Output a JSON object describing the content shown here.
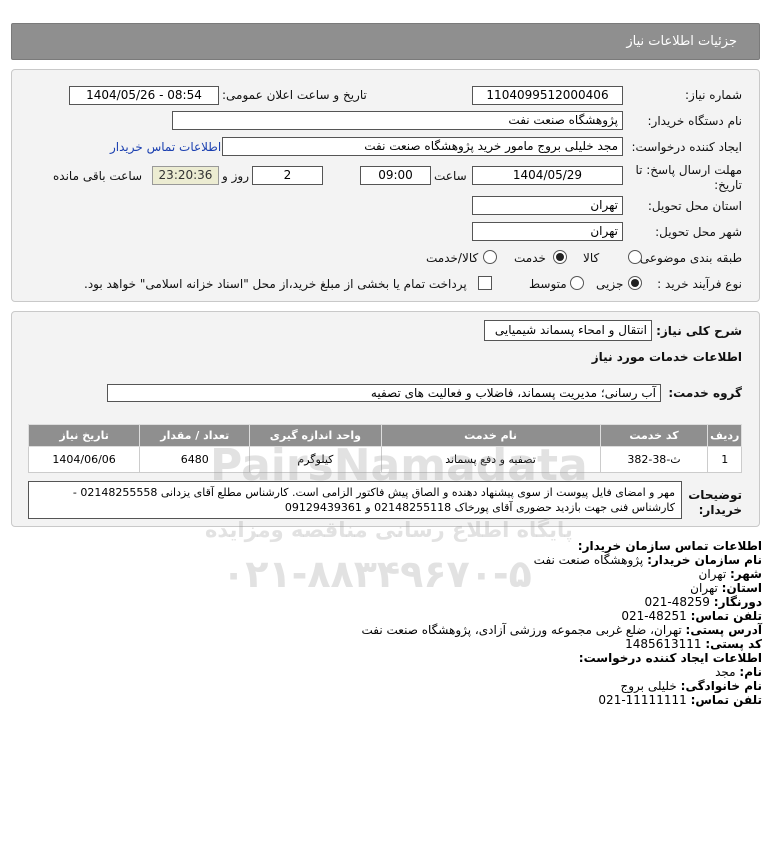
{
  "header": {
    "title": "جزئیات اطلاعات نیاز"
  },
  "form": {
    "need_number_label": "شماره نیاز:",
    "need_number": "1104099512000406",
    "announce_label": "تاریخ و ساعت اعلان عمومی:",
    "announce_value": "1404/05/26 - 08:54",
    "buyer_org_label": "نام دستگاه خریدار:",
    "buyer_org": "پژوهشگاه صنعت نفت",
    "creator_label": "ایجاد کننده درخواست:",
    "creator": "مجد خلیلی بروج مامور خرید پژوهشگاه صنعت نفت",
    "contact_link": "اطلاعات تماس خریدار",
    "deadline_label_1": "مهلت ارسال پاسخ: تا",
    "deadline_label_2": "تاریخ:",
    "deadline_date": "1404/05/29",
    "time_label": "ساعت",
    "deadline_time": "09:00",
    "days": "2",
    "days_label": "روز و",
    "remaining": "23:20:36",
    "remaining_label": "ساعت باقی مانده",
    "province_label": "استان محل تحویل:",
    "province": "تهران",
    "city_label": "شهر محل تحویل:",
    "city": "تهران",
    "category_label": "طبقه بندی موضوعی:",
    "category_options": [
      "کالا",
      "خدمت",
      "کالا/خدمت"
    ],
    "category_selected": "خدمت",
    "purchase_label": "نوع فرآیند خرید :",
    "purchase_options": [
      "جزیی",
      "متوسط"
    ],
    "purchase_selected": "جزیی",
    "treasury_note": "پرداخت تمام یا بخشی از مبلغ خرید،از محل \"اسناد خزانه اسلامی\" خواهد بود."
  },
  "summary": {
    "label": "شرح کلی نیاز:",
    "value": "انتقال و امحاء پسماند شیمیایی",
    "services_heading": "اطلاعات خدمات مورد نیاز",
    "group_label": "گروه خدمت:",
    "group_value": "آب رسانی؛ مدیریت پسماند، فاضلاب و فعالیت های تصفیه"
  },
  "table": {
    "headers": [
      "ردیف",
      "کد خدمت",
      "نام خدمت",
      "واحد اندازه گیری",
      "تعداد / مقدار",
      "تاریخ نیاز"
    ],
    "rows": [
      [
        "1",
        "ث-38-382",
        "تصفیه و دفع پسماند",
        "کیلوگرم",
        "6480",
        "1404/06/06"
      ]
    ]
  },
  "notes": {
    "label_1": "توضیحات",
    "label_2": "خریدار:",
    "text": "مهر و امضای فایل پیوست از سوی پیشنهاد دهنده و الصاق پیش فاکتور الزامی است. کارشناس مطلع آقای یزدانی 02148255558 - کارشناس فنی جهت بازدید حضوری آقای پورخاک 02148255118 و 09129439361"
  },
  "buyer_contact": {
    "heading": "اطلاعات تماس سازمان خریدار:",
    "org_label": "نام سازمان خریدار:",
    "org": "پژوهشگاه صنعت نفت",
    "city_label": "شهر:",
    "city": "تهران",
    "province_label": "استان:",
    "province": "تهران",
    "fax_label": "دورنگار:",
    "fax": "021-48259",
    "phone_label": "تلفن تماس:",
    "phone": "021-48251",
    "address_label": "آدرس پستی:",
    "address": "تهران، ضلع غربی مجموعه ورزشی آزادی، پژوهشگاه صنعت نفت",
    "postal_label": "کد پستی:",
    "postal": "1485613111"
  },
  "creator_contact": {
    "heading": "اطلاعات ایجاد کننده درخواست:",
    "name_label": "نام:",
    "name": "مجد",
    "family_label": "نام خانوادگی:",
    "family": "خلیلی بروج",
    "phone_label": "تلفن تماس:",
    "phone": "021-11111111"
  },
  "watermark": {
    "line1": "PairsNamadata",
    "line2": "پایگاه اطلاع رسانی مناقصه ومزایده",
    "line3": "۰۲۱-۸۸۳۴۹۶۷۰-۵"
  }
}
